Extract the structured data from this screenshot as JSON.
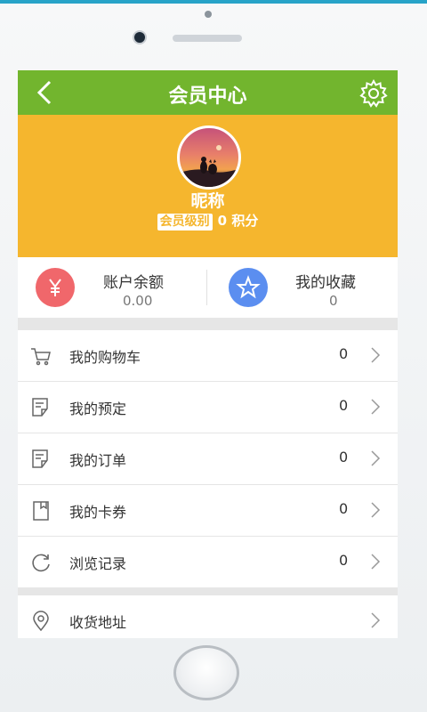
{
  "header": {
    "title": "会员中心",
    "back_icon": "back-arrow-icon",
    "settings_icon": "gear-icon"
  },
  "profile": {
    "nickname": "昵称",
    "level_badge": "会员级别",
    "points": "0 积分"
  },
  "stats": {
    "balance": {
      "label": "账户余额",
      "value": "0.00",
      "icon": "yen-icon",
      "color": "#f0676b"
    },
    "favorites": {
      "label": "我的收藏",
      "value": "0",
      "icon": "star-icon",
      "color": "#5b8ef0"
    }
  },
  "menu": [
    {
      "label": "我的购物车",
      "count": "0",
      "icon": "cart-icon"
    },
    {
      "label": "我的预定",
      "count": "0",
      "icon": "note-icon"
    },
    {
      "label": "我的订单",
      "count": "0",
      "icon": "note-icon"
    },
    {
      "label": "我的卡券",
      "count": "0",
      "icon": "card-icon"
    },
    {
      "label": "浏览记录",
      "count": "0",
      "icon": "refresh-icon"
    }
  ],
  "menu2": [
    {
      "label": "收货地址",
      "icon": "location-icon"
    }
  ],
  "colors": {
    "header": "#72b52e",
    "profile_bg": "#f5b62e"
  }
}
